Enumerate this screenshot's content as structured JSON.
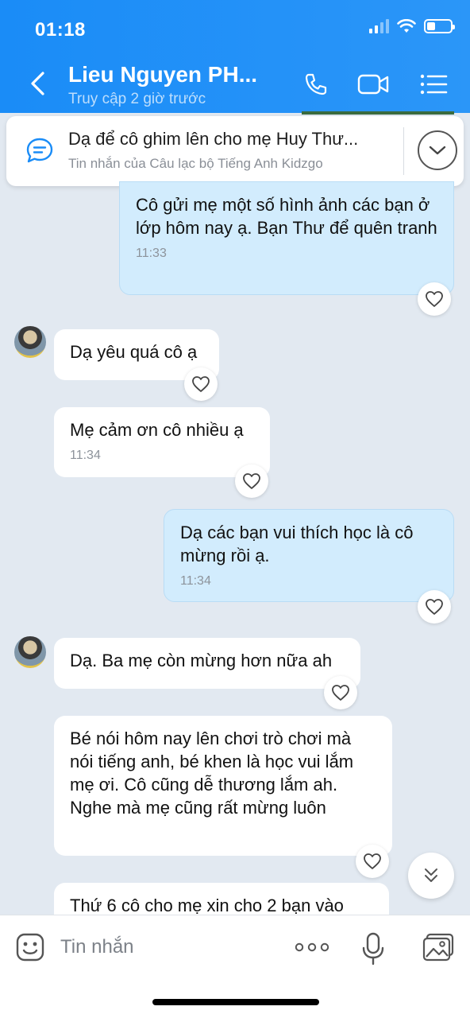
{
  "status_bar": {
    "time": "01:18"
  },
  "header": {
    "contact_name": "Lieu Nguyen PH...",
    "last_seen": "Truy cập 2 giờ trước"
  },
  "pinned": {
    "text": "Dạ để cô ghim lên cho mẹ Huy Thư...",
    "subtitle": "Tin nhắn của Câu lạc bộ Tiếng Anh Kidzgo"
  },
  "messages": [
    {
      "direction": "out",
      "text": "Cô gửi mẹ một số hình ảnh các bạn ở lớp hôm nay ạ. Bạn Thư để quên tranh",
      "time": "11:33"
    },
    {
      "direction": "in",
      "text": "Dạ yêu quá cô ạ",
      "time": ""
    },
    {
      "direction": "in",
      "text": "Mẹ cảm ơn cô nhiều ạ",
      "time": "11:34"
    },
    {
      "direction": "out",
      "text": "Dạ các bạn vui thích học là cô mừng rồi ạ.",
      "time": "11:34"
    },
    {
      "direction": "in",
      "text": "Dạ. Ba mẹ còn mừng hơn nữa ah",
      "time": ""
    },
    {
      "direction": "in",
      "text": "Bé nói hôm nay lên chơi trò chơi mà nói tiếng anh, bé khen là học vui lắm mẹ ơi. Cô cũng dễ thương lắm ah. Nghe mà mẹ cũng rất mừng luôn",
      "time": ""
    },
    {
      "direction": "in",
      "text": "Thứ 6 cô cho mẹ xin cho 2 bạn vào",
      "time": ""
    }
  ],
  "input": {
    "placeholder": "Tin nhắn"
  },
  "colors": {
    "header": "#1a8cf7",
    "outgoing_bubble": "#d2ecfd",
    "incoming_bubble": "#ffffff",
    "background": "#e2e9f1"
  }
}
